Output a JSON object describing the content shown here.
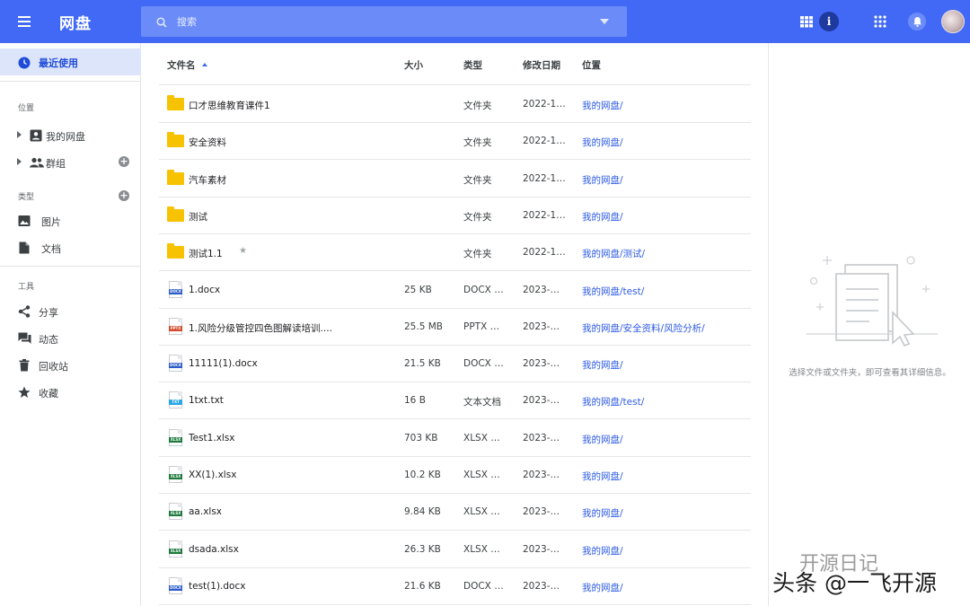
{
  "header": {
    "title": "网盘",
    "search_placeholder": "搜索",
    "brand_color": "#4169f5",
    "icons": [
      "menu-icon",
      "search-icon",
      "dropdown-icon",
      "grid-view-icon",
      "info-icon",
      "apps-icon",
      "bell-icon"
    ]
  },
  "sidebar": {
    "recent_label": "最近使用",
    "location_title": "位置",
    "my_drive_label": "我的网盘",
    "groups_label": "群组",
    "types_title": "类型",
    "images_label": "图片",
    "docs_label": "文档",
    "tools_title": "工具",
    "share_label": "分享",
    "activity_label": "动态",
    "trash_label": "回收站",
    "favorites_label": "收藏",
    "plus": "+"
  },
  "table": {
    "headers": {
      "name": "文件名",
      "size": "大小",
      "type": "类型",
      "date": "修改日期",
      "location": "位置"
    },
    "rows": [
      {
        "name": "口才思维教育课件1",
        "size": "",
        "type": "文件夹",
        "date": "2022-1…",
        "location": "我的网盘/",
        "icon": "folder"
      },
      {
        "name": "安全资料",
        "size": "",
        "type": "文件夹",
        "date": "2022-1…",
        "location": "我的网盘/",
        "icon": "folder"
      },
      {
        "name": "汽车素材",
        "size": "",
        "type": "文件夹",
        "date": "2022-1…",
        "location": "我的网盘/",
        "icon": "folder"
      },
      {
        "name": "测试",
        "size": "",
        "type": "文件夹",
        "date": "2022-1…",
        "location": "我的网盘/",
        "icon": "folder"
      },
      {
        "name": "测试1.1",
        "size": "",
        "type": "文件夹",
        "date": "2022-1…",
        "location": "我的网盘/测试/",
        "icon": "folder",
        "starred": true
      },
      {
        "name": "1.docx",
        "size": "25 KB",
        "type": "DOCX …",
        "date": "2023-…",
        "location": "我的网盘/test/",
        "icon": "docx"
      },
      {
        "name": "1.风险分级管控四色图解读培训....",
        "size": "25.5 MB",
        "type": "PPTX …",
        "date": "2023-…",
        "location": "我的网盘/安全资料/风险分析/",
        "icon": "pptx"
      },
      {
        "name": "11111(1).docx",
        "size": "21.5 KB",
        "type": "DOCX …",
        "date": "2023-…",
        "location": "我的网盘/",
        "icon": "docx"
      },
      {
        "name": "1txt.txt",
        "size": "16 B",
        "type": "文本文档",
        "date": "2023-…",
        "location": "我的网盘/test/",
        "icon": "txt"
      },
      {
        "name": "Test1.xlsx",
        "size": "703 KB",
        "type": "XLSX …",
        "date": "2023-…",
        "location": "我的网盘/",
        "icon": "xlsx"
      },
      {
        "name": "XX(1).xlsx",
        "size": "10.2 KB",
        "type": "XLSX …",
        "date": "2023-…",
        "location": "我的网盘/",
        "icon": "xlsx"
      },
      {
        "name": "aa.xlsx",
        "size": "9.84 KB",
        "type": "XLSX …",
        "date": "2023-…",
        "location": "我的网盘/",
        "icon": "xlsx"
      },
      {
        "name": "dsada.xlsx",
        "size": "26.3 KB",
        "type": "XLSX …",
        "date": "2023-…",
        "location": "我的网盘/",
        "icon": "xlsx"
      },
      {
        "name": "test(1).docx",
        "size": "21.6 KB",
        "type": "DOCX …",
        "date": "2023-…",
        "location": "我的网盘/",
        "icon": "docx"
      }
    ],
    "icon_tags": {
      "docx": "DOCX",
      "pptx": "PPTX",
      "txt": "TXT",
      "xlsx": "XLSX"
    },
    "icon_colors": {
      "docx": "#2b5cc9",
      "pptx": "#d24b2c",
      "txt": "#2aa7e6",
      "xlsx": "#1e7a3c",
      "folder": "#f7c200"
    },
    "star": "★"
  },
  "detail": {
    "hint": "选择文件或文件夹，即可查看其详细信息。"
  },
  "watermark": {
    "top": "开源日记",
    "bottom": "头条 @一飞开源"
  }
}
